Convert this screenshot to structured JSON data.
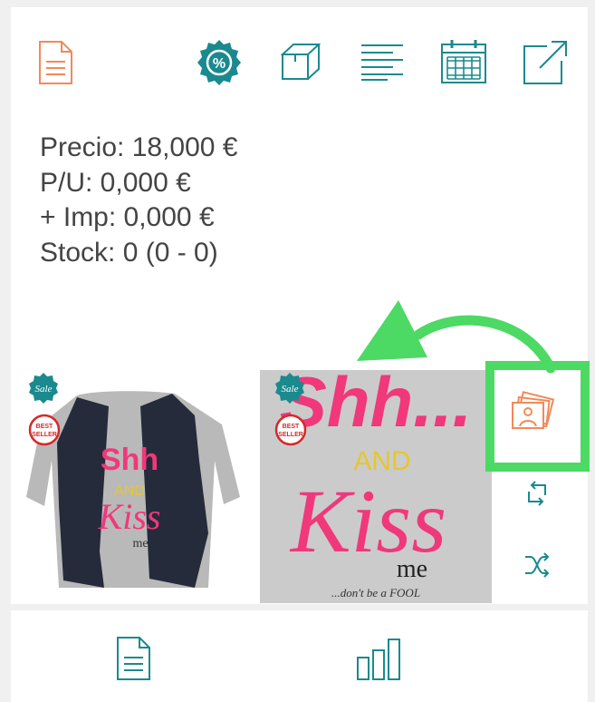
{
  "toolbar": {
    "icons": [
      "document-icon",
      "discount-badge-icon",
      "box-icon",
      "list-icon",
      "calendar-icon",
      "external-link-icon"
    ]
  },
  "product_info": {
    "price_line": "Precio: 18,000 €",
    "unit_price_line": "P/U: 0,000 €",
    "tax_line": "+ Imp: 0,000 €",
    "stock_line": "Stock: 0 (0 - 0)"
  },
  "product_images": [
    {
      "badge": "Sale",
      "tag": "BEST SELLER",
      "art_text": "Shh AND Kiss me"
    },
    {
      "badge": "Sale",
      "tag": "BEST SELLER",
      "art_text": "Shh... AND Kiss me ...don't be a FOOL"
    }
  ],
  "side_actions": [
    "images-icon",
    "swap-icon",
    "shuffle-icon"
  ],
  "bottom_nav": [
    "document-icon",
    "bar-chart-icon"
  ],
  "colors": {
    "teal": "#1a8a8f",
    "orange": "#f08a5a",
    "highlight_green": "#4cd964",
    "pink": "#f0387a",
    "text": "#444444"
  }
}
